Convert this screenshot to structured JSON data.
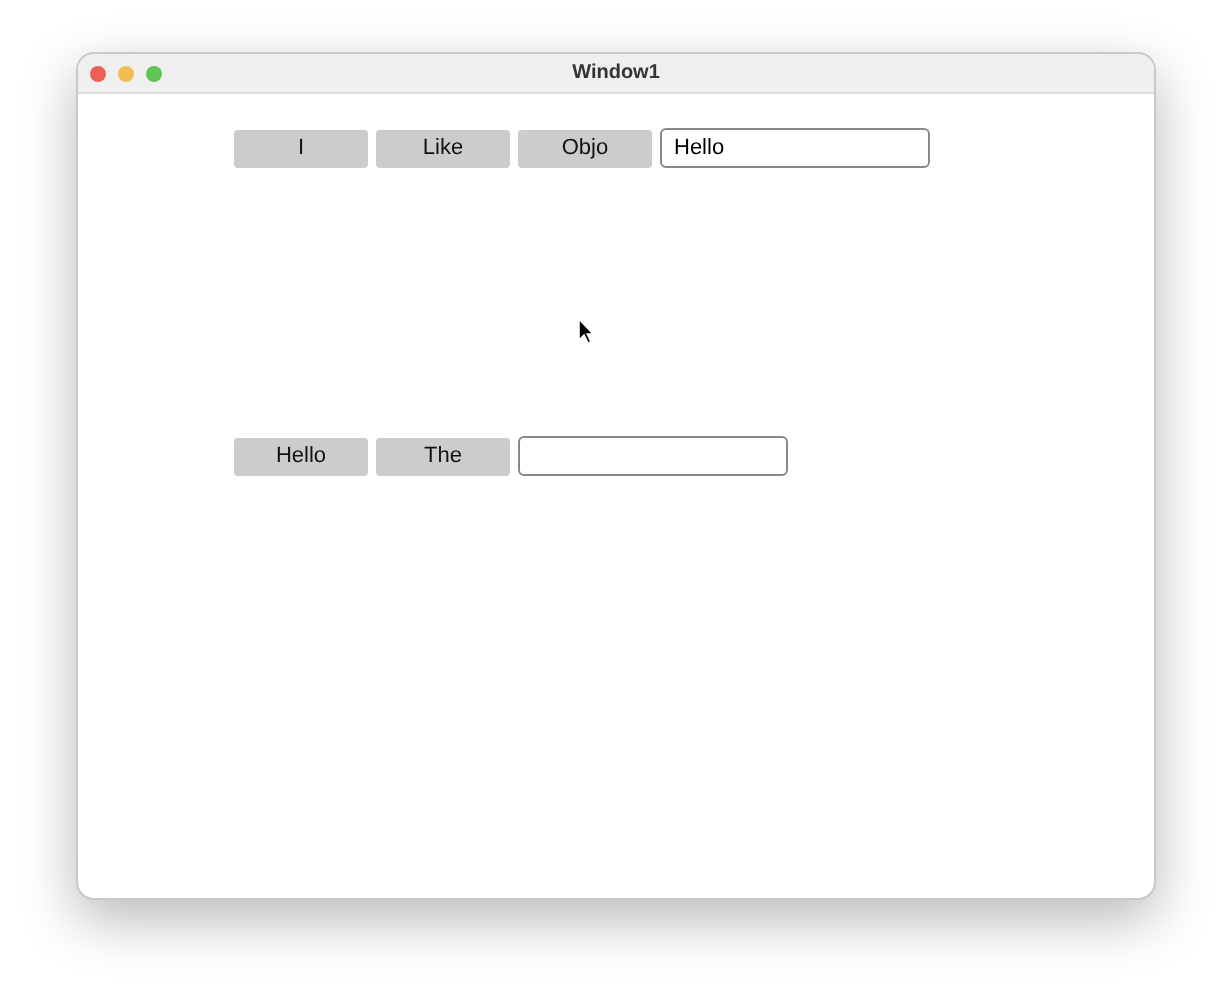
{
  "window": {
    "title": "Window1"
  },
  "rows": [
    {
      "buttons": [
        "I",
        "Like",
        "Objo"
      ],
      "field": {
        "value": "Hello"
      }
    },
    {
      "buttons": [
        "Hello",
        "The"
      ],
      "field": {}
    }
  ]
}
